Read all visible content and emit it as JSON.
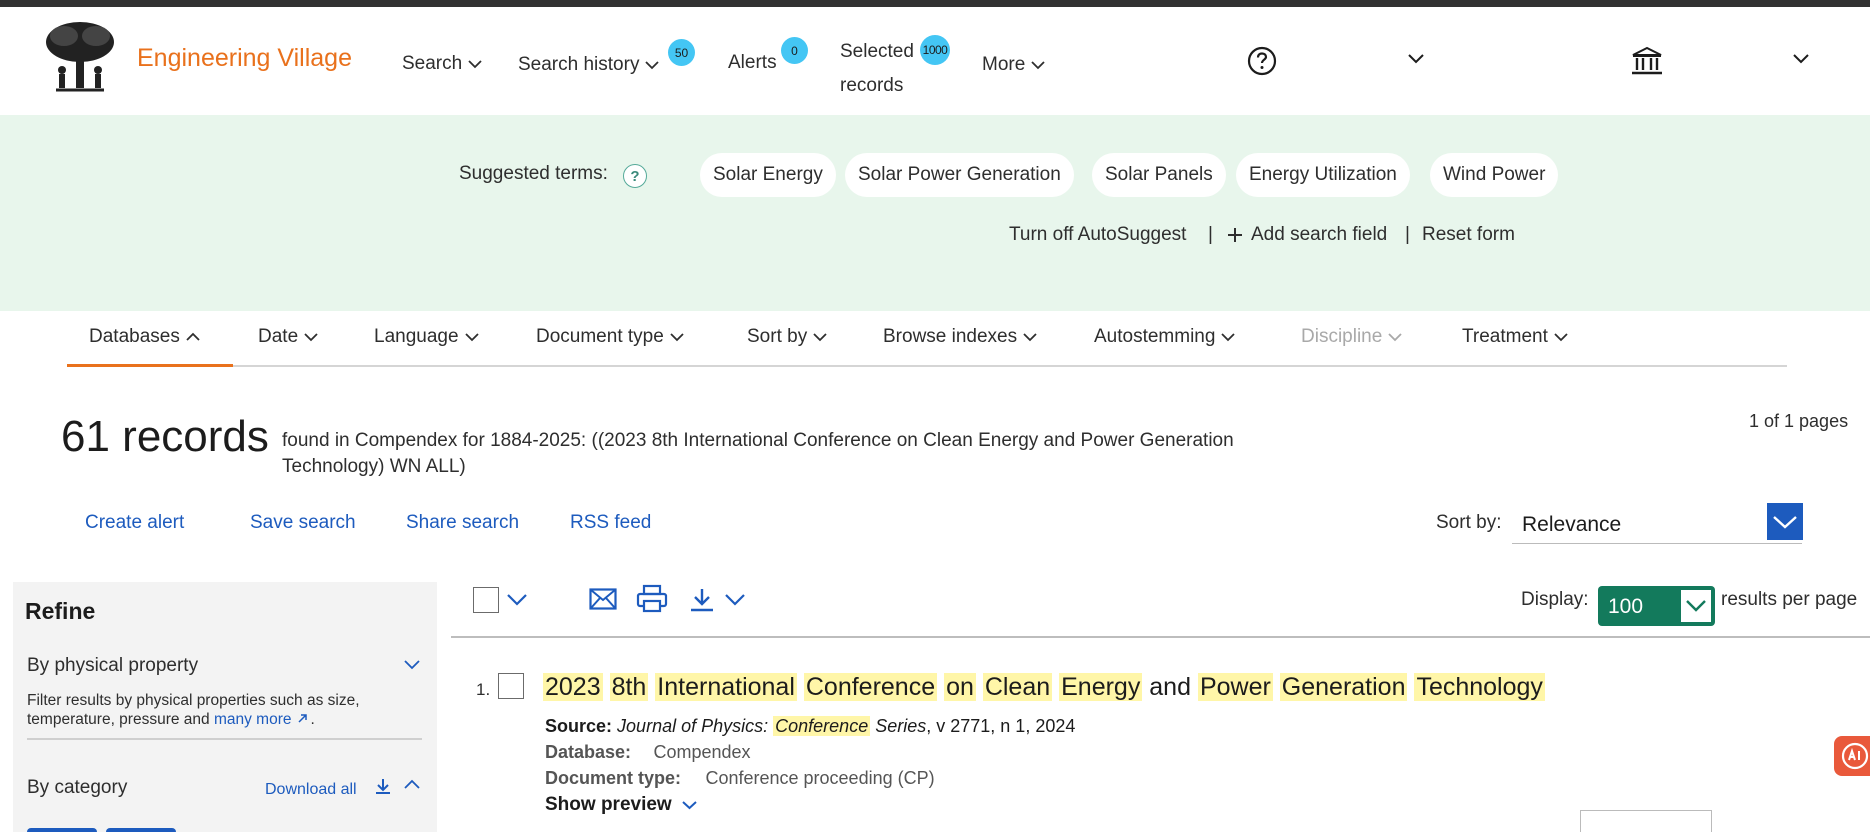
{
  "header": {
    "brand": "Engineering Village",
    "nav": {
      "search": "Search",
      "search_history": "Search history",
      "search_history_badge": "50",
      "alerts": "Alerts",
      "alerts_badge": "0",
      "selected_records_line1": "Selected",
      "selected_records_line2": "records",
      "selected_records_badge": "1000",
      "more": "More"
    }
  },
  "suggest": {
    "label": "Suggested terms:",
    "help_icon": "?",
    "chips": [
      "Solar Energy",
      "Solar Power Generation",
      "Solar Panels",
      "Energy Utilization",
      "Wind Power"
    ],
    "turn_off": "Turn off AutoSuggest",
    "sep": "|",
    "add_field": "Add search field",
    "reset": "Reset form"
  },
  "tabs": {
    "databases": "Databases",
    "date": "Date",
    "language": "Language",
    "document_type": "Document type",
    "sort_by": "Sort by",
    "browse_indexes": "Browse indexes",
    "autostemming": "Autostemming",
    "discipline": "Discipline",
    "treatment": "Treatment"
  },
  "results": {
    "count": "61 records",
    "query_line1": "found in Compendex for 1884-2025: ((2023 8th International Conference on Clean Energy and Power Generation",
    "query_line2": "Technology) WN ALL)",
    "pages": "1 of 1 pages",
    "actions": {
      "create_alert": "Create alert",
      "save_search": "Save search",
      "share_search": "Share search",
      "rss_feed": "RSS feed"
    },
    "sort_label": "Sort by:",
    "sort_value": "Relevance",
    "display_label": "Display:",
    "display_value": "100",
    "per_page": "results per page"
  },
  "refine": {
    "title": "Refine",
    "physical_property": "By physical property",
    "physical_desc_line1": "Filter results by physical properties such as size,",
    "physical_desc_line2": "temperature, pressure and",
    "many_more": "many more",
    "period": ".",
    "category": "By category",
    "download_all": "Download all"
  },
  "record": {
    "number": "1.",
    "title_words": [
      "2023",
      "8th",
      "International",
      "Conference",
      "on",
      "Clean",
      "Energy",
      "and",
      "Power",
      "Generation",
      "Technology"
    ],
    "title_highlight": [
      true,
      true,
      true,
      true,
      true,
      true,
      true,
      false,
      true,
      true,
      true
    ],
    "source_label": "Source:",
    "source_journal_1": "Journal of Physics:",
    "source_journal_hl": "Conference",
    "source_journal_2": "Series",
    "source_rest": ", v 2771, n 1, 2024",
    "database_label": "Database:",
    "database_value": "Compendex",
    "doctype_label": "Document type:",
    "doctype_value": "Conference proceeding (CP)",
    "show_preview": "Show preview"
  },
  "colors": {
    "brand_orange": "#e9711c",
    "link_blue": "#1d5bbe",
    "badge_blue": "#44c6f4",
    "suggest_bg": "#e8f6ec",
    "display_green": "#137a5c",
    "highlight": "#fff6a8"
  }
}
